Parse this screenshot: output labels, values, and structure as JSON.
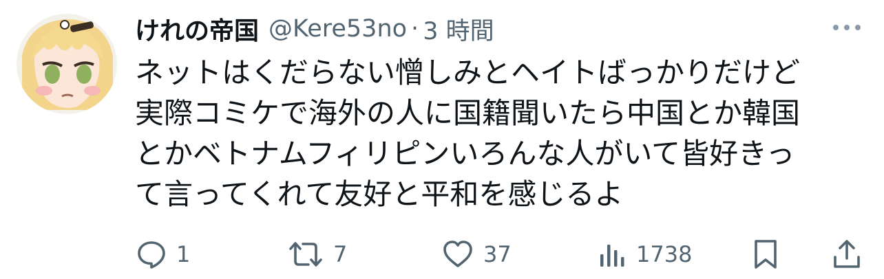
{
  "tweet": {
    "display_name": "けれの帝国",
    "handle": "@Kere53no",
    "separator": "·",
    "time": "3 時間",
    "avatar_icon": "anime-avatar-icon",
    "more_icon": "more-dots-icon",
    "text_lines": [
      "ネットはくだらない憎しみとヘイトばっかりだけど",
      "実際コミケで海外の人に国籍聞いたら中国とか韓国",
      "とかベトナムフィリピンいろんな人がいて皆好きっ",
      "て言ってくれて友好と平和を感じるよ"
    ]
  },
  "actions": {
    "reply": {
      "icon": "reply-icon",
      "count": "1"
    },
    "retweet": {
      "icon": "retweet-icon",
      "count": "7"
    },
    "like": {
      "icon": "heart-icon",
      "count": "37"
    },
    "views": {
      "icon": "views-icon",
      "count": "1738"
    },
    "bookmark": {
      "icon": "bookmark-icon"
    },
    "share": {
      "icon": "share-icon"
    }
  },
  "colors": {
    "text": "#0f1419",
    "secondary": "#536471"
  }
}
